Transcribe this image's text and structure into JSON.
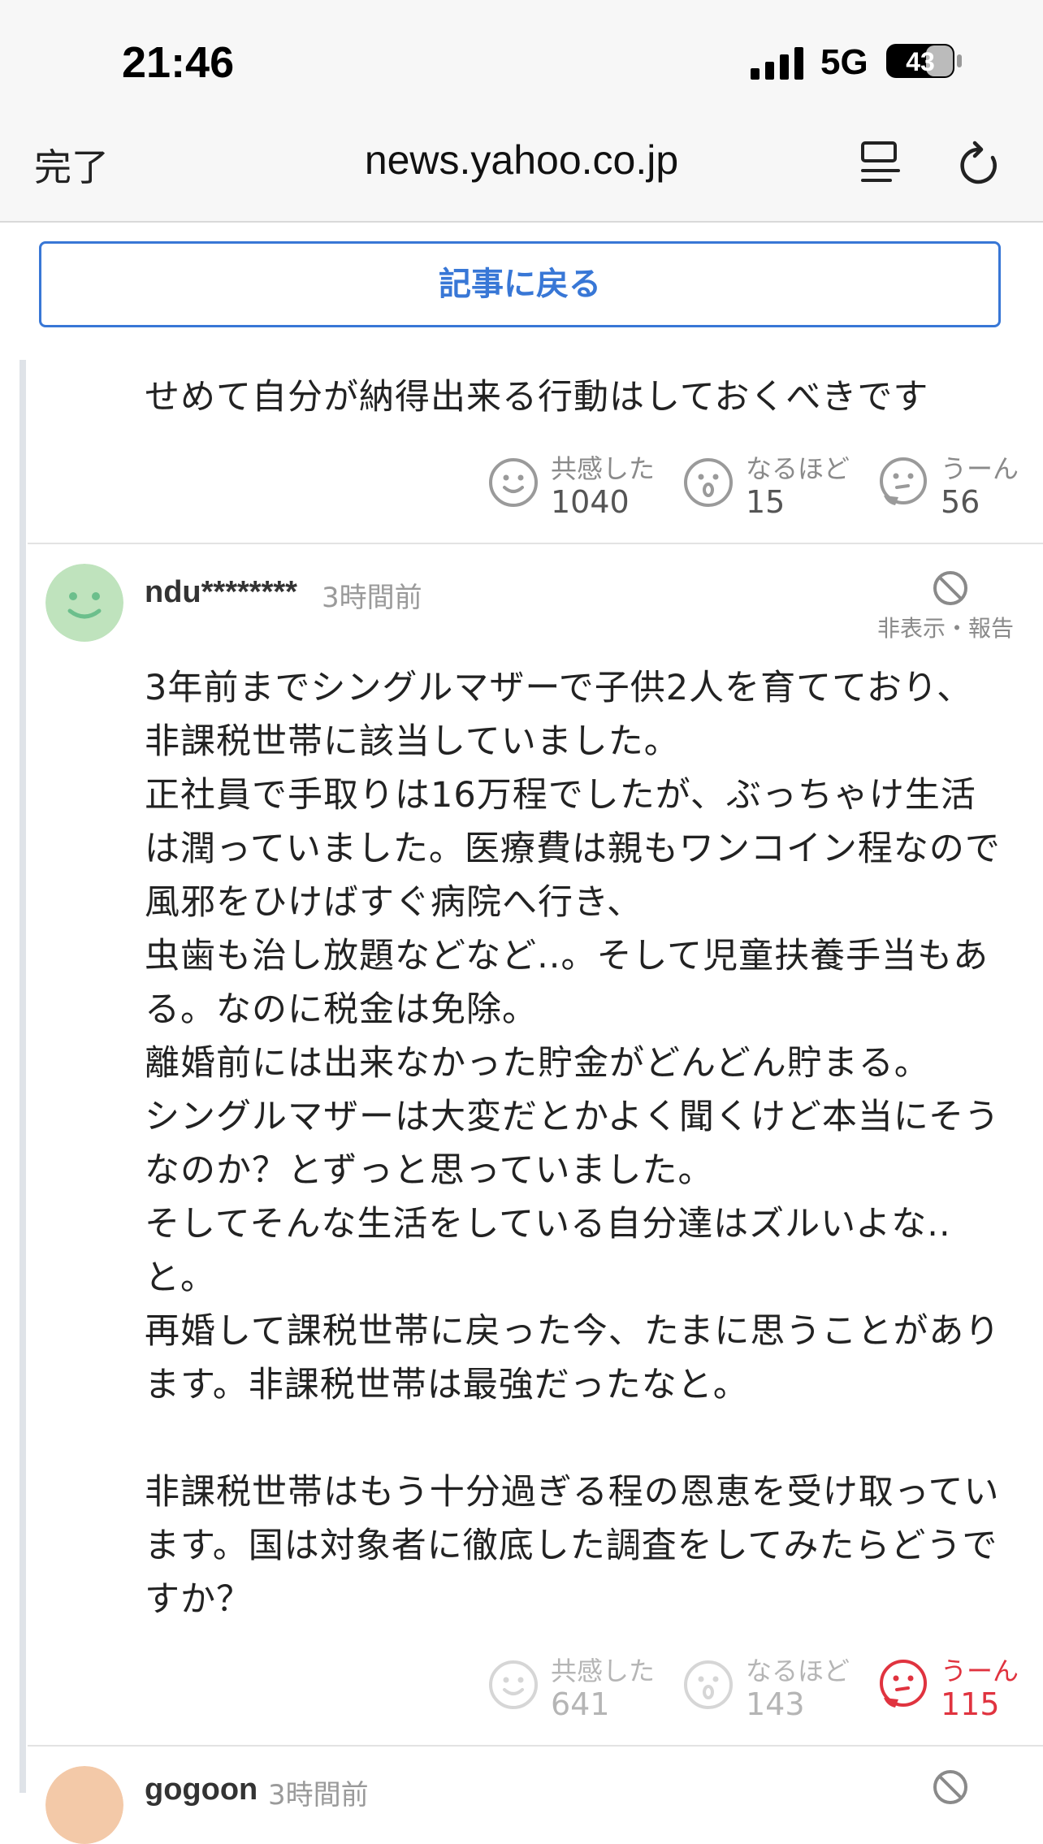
{
  "status_bar": {
    "time": "21:46",
    "network": "5G",
    "battery": "43"
  },
  "browser": {
    "done_label": "完了",
    "url": "news.yahoo.co.jp"
  },
  "back_button": {
    "label": "記事に戻る"
  },
  "comments": [
    {
      "text": "せめて自分が納得出来る行動はしておくべきです",
      "reactions": [
        {
          "label": "共感した",
          "count": "1040",
          "icon": "smile-face-icon"
        },
        {
          "label": "なるほど",
          "count": "15",
          "icon": "surprised-face-icon"
        },
        {
          "label": "うーん",
          "count": "56",
          "icon": "thinking-face-icon"
        }
      ]
    },
    {
      "username": "ndu********",
      "timestamp": "3時間前",
      "hide_report_label": "非表示・報告",
      "text": "3年前までシングルマザーで子供2人を育てており、\n非課税世帯に該当していました。\n正社員で手取りは16万程でしたが、ぶっちゃけ生活\nは潤っていました。医療費は親もワンコイン程なので\n風邪をひけばすぐ病院へ行き、\n虫歯も治し放題などなど..。そして児童扶養手当もあ\nる。なのに税金は免除。\n離婚前には出来なかった貯金がどんどん貯まる。\nシングルマザーは大変だとかよく聞くけど本当にそう\nなのか？とずっと思っていました。\nそしてそんな生活をしている自分達はズルいよな..\nと。\n再婚して課税世帯に戻った今、たまに思うことがあり\nます。非課税世帯は最強だったなと。\n\n非課税世帯はもう十分過ぎる程の恩恵を受け取ってい\nます。国は対象者に徹底した調査をしてみたらどうで\nすか？",
      "reactions": [
        {
          "label": "共感した",
          "count": "641",
          "icon": "smile-face-icon"
        },
        {
          "label": "なるほど",
          "count": "143",
          "icon": "surprised-face-icon"
        },
        {
          "label": "うーん",
          "count": "115",
          "icon": "thinking-face-icon"
        }
      ],
      "accent_color": "#e0333f"
    },
    {
      "username": "gogoon",
      "timestamp": "3時間前"
    }
  ]
}
